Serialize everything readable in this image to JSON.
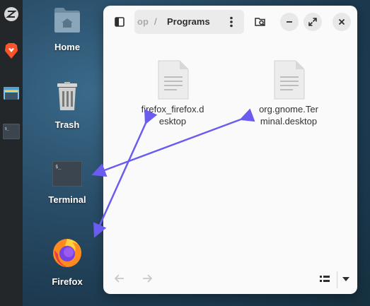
{
  "dock": {
    "items": [
      {
        "name": "zorin-menu-icon"
      },
      {
        "name": "brave-browser-icon"
      },
      {
        "name": "files-icon"
      },
      {
        "name": "terminal-icon"
      }
    ]
  },
  "desktop": {
    "icons": [
      {
        "label": "Home"
      },
      {
        "label": "Trash"
      },
      {
        "label": "Terminal"
      },
      {
        "label": "Firefox"
      }
    ]
  },
  "window": {
    "path_prev": "op",
    "path_sep": "/",
    "path_current": "Programs",
    "files": [
      {
        "line1": "firefox_firefox.d",
        "line2": "esktop"
      },
      {
        "line1": "org.gnome.Ter",
        "line2": "minal.desktop"
      }
    ]
  },
  "colors": {
    "arrow": "#6a5cf0",
    "window_bg": "#fafafa",
    "dock_bg": "#232729"
  }
}
